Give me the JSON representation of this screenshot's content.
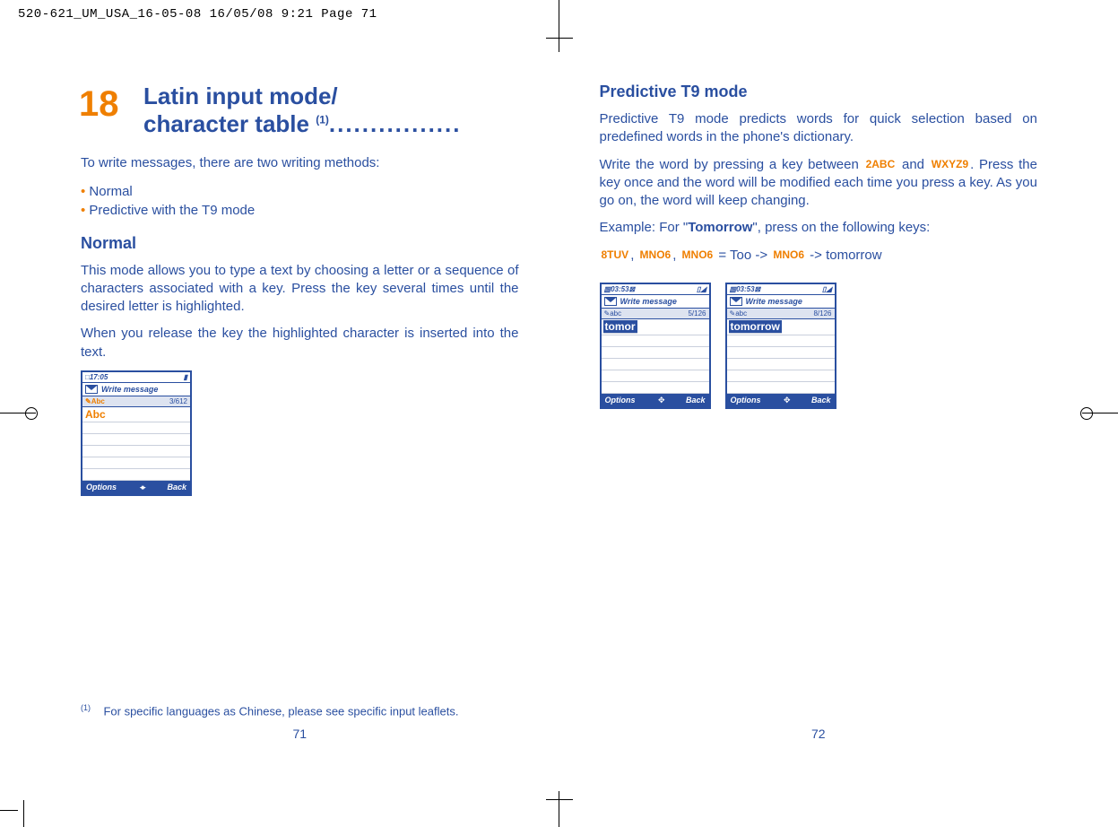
{
  "print_header": "520-621_UM_USA_16-05-08  16/05/08  9:21  Page 71",
  "left": {
    "chapter_number": "18",
    "title_line1": "Latin input mode/",
    "title_line2_a": "character table ",
    "title_sup": "(1)",
    "title_dots": "................",
    "intro": "To write messages, there are two writing methods:",
    "bullet1": "Normal",
    "bullet2": "Predictive with the T9 mode",
    "h2": "Normal",
    "p1": "This mode allows you to type a text by choosing a letter or a sequence of characters associated with a key. Press the key several times until the desired letter is highlighted.",
    "p2": "When you release the key the highlighted character is inserted into the text.",
    "phone": {
      "time": "17:05",
      "title": "Write message",
      "mode": "Abc",
      "counter": "3/612",
      "typed": "Abc",
      "soft_left": "Options",
      "soft_right": "Back"
    },
    "footnote_sup": "(1)",
    "footnote": "For specific languages as Chinese, please see specific input leaflets.",
    "pagenum": "71"
  },
  "right": {
    "h2": "Predictive T9 mode",
    "p1a": "Predictive T9 mode predicts words for quick selection based on predefined words in the phone's dictionary.",
    "p2a": "Write the word by pressing a key between ",
    "key2": "2ABC",
    "p2b": " and ",
    "key9": "WXYZ9",
    "p2c": ". Press the key once and the word will be modified each time you press a key. As you go on, the word will keep changing.",
    "ex_a": "Example: For \"",
    "ex_b": "Tomorrow",
    "ex_c": "\", press on the following keys:",
    "seq_k8": "8TUV",
    "seq_sep1": ", ",
    "seq_k6a": "MNO6",
    "seq_sep2": ", ",
    "seq_k6b": "MNO6",
    "seq_eq": " = Too -> ",
    "seq_k6c": "MNO6",
    "seq_tail": " -> tomorrow",
    "phoneA": {
      "time": "03:53",
      "title": "Write message",
      "mode": "abc",
      "counter": "5/126",
      "typed": "tomor",
      "soft_left": "Options",
      "soft_right": "Back"
    },
    "phoneB": {
      "time": "03:53",
      "title": "Write message",
      "mode": "abc",
      "counter": "8/126",
      "typed": "tomorrow",
      "soft_left": "Options",
      "soft_right": "Back"
    },
    "pagenum": "72"
  }
}
